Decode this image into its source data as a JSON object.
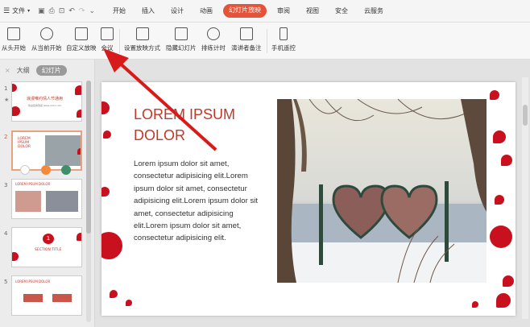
{
  "menubar": {
    "menu_icon": "hamburger-icon",
    "file_label": "文件",
    "tabs": [
      {
        "label": "开始"
      },
      {
        "label": "插入"
      },
      {
        "label": "设计"
      },
      {
        "label": "动画"
      },
      {
        "label": "幻灯片放映",
        "active": true
      },
      {
        "label": "审阅"
      },
      {
        "label": "视图"
      },
      {
        "label": "安全"
      },
      {
        "label": "云服务"
      }
    ]
  },
  "ribbon": {
    "buttons": [
      {
        "label": "从头开始",
        "icon": "play-from-start-icon"
      },
      {
        "label": "从当前开始",
        "icon": "play-current-icon"
      },
      {
        "label": "自定义放映",
        "icon": "custom-show-icon"
      },
      {
        "label": "会议",
        "icon": "meeting-icon"
      },
      {
        "label": "设置放映方式",
        "icon": "setup-show-icon"
      },
      {
        "label": "隐藏幻灯片",
        "icon": "hide-slide-icon"
      },
      {
        "label": "排练计时",
        "icon": "timer-icon"
      },
      {
        "label": "演讲者备注",
        "icon": "speaker-notes-icon"
      },
      {
        "label": "手机遥控",
        "icon": "phone-remote-icon"
      }
    ]
  },
  "panel": {
    "tab_outline": "大纲",
    "tab_slides": "幻灯片",
    "close_glyph": "×",
    "thumbs": [
      {
        "num": "1",
        "title": "浪漫唯约情人节通用",
        "sub": "欢迎您的到来 www.xxxx.com"
      },
      {
        "num": "2",
        "title": "LOREM IPSUM DOLOR"
      },
      {
        "num": "3",
        "title": "LOREM IPSUM DOLOR"
      },
      {
        "num": "4",
        "title": "SECTION TITLE",
        "badge": "1"
      },
      {
        "num": "5",
        "title": "LOREM IPSUM DOLOR"
      }
    ],
    "star": "★"
  },
  "slide": {
    "title": "LOREM IPSUM DOLOR",
    "body": "Lorem ipsum dolor sit amet, consectetur adipisicing elit.Lorem ipsum dolor sit amet, consectetur adipisicing elit.Lorem ipsum dolor sit amet, consectetur adipisicing elit.Lorem ipsum dolor sit amet, consectetur adipisicing elit."
  },
  "colors": {
    "accent": "#e4543a",
    "title_red": "#c0392b",
    "arrow_red": "#d91a1a"
  }
}
